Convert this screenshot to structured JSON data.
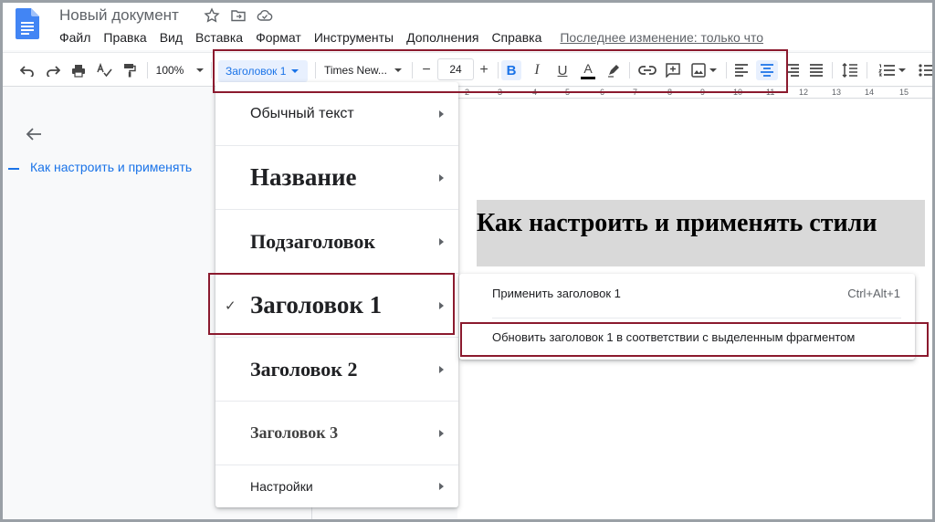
{
  "header": {
    "doc_title": "Новый документ",
    "menu": [
      "Файл",
      "Правка",
      "Вид",
      "Вставка",
      "Формат",
      "Инструменты",
      "Дополнения",
      "Справка"
    ],
    "last_edit": "Последнее изменение: только что"
  },
  "toolbar": {
    "zoom": "100%",
    "style": "Заголовок 1",
    "font": "Times New...",
    "font_size": "24",
    "minus": "−",
    "plus": "+",
    "bold": "B",
    "italic": "I",
    "underline": "U",
    "text_color": "A"
  },
  "ruler": [
    "2",
    "3",
    "4",
    "5",
    "6",
    "7",
    "8",
    "9",
    "10",
    "11",
    "12",
    "13",
    "14",
    "15"
  ],
  "outline": {
    "item": "Как настроить и применять"
  },
  "document": {
    "heading": "Как настроить и применять стили"
  },
  "dropdown": {
    "items": [
      {
        "label": "Обычный текст"
      },
      {
        "label": "Название"
      },
      {
        "label": "Подзаголовок"
      },
      {
        "label": "Заголовок 1"
      },
      {
        "label": "Заголовок 2"
      },
      {
        "label": "Заголовок 3"
      },
      {
        "label": "Настройки"
      }
    ],
    "checkmark": "✓"
  },
  "submenu": {
    "apply_label": "Применить заголовок 1",
    "apply_shortcut": "Ctrl+Alt+1",
    "update_label": "Обновить заголовок 1 в соответствии с выделенным фрагментом"
  },
  "colors": {
    "accent": "#1a73e8",
    "highlight_box": "#8b1a2e"
  }
}
